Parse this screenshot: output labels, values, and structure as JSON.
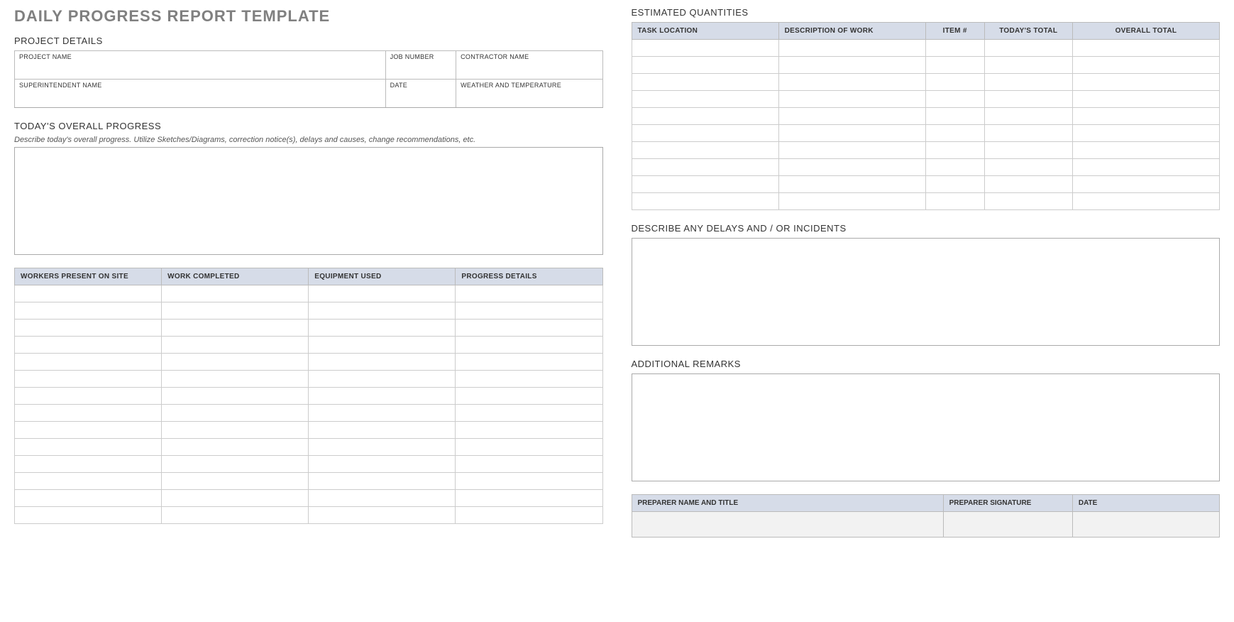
{
  "title": "DAILY PROGRESS REPORT TEMPLATE",
  "sections": {
    "project_details": "PROJECT DETAILS",
    "todays_progress": "TODAY'S OVERALL PROGRESS",
    "estimated_quantities": "ESTIMATED QUANTITIES",
    "delays": "DESCRIBE ANY DELAYS AND / OR INCIDENTS",
    "remarks": "ADDITIONAL REMARKS"
  },
  "project_details": {
    "fields": {
      "project_name": {
        "label": "PROJECT NAME",
        "value": ""
      },
      "job_number": {
        "label": "JOB NUMBER",
        "value": ""
      },
      "contractor_name": {
        "label": "CONTRACTOR NAME",
        "value": ""
      },
      "superintendent_name": {
        "label": "SUPERINTENDENT NAME",
        "value": ""
      },
      "date": {
        "label": "DATE",
        "value": ""
      },
      "weather": {
        "label": "WEATHER AND TEMPERATURE",
        "value": ""
      }
    }
  },
  "todays_progress": {
    "hint": "Describe today's overall progress.  Utilize Sketches/Diagrams, correction notice(s), delays and causes, change recommendations, etc.",
    "value": ""
  },
  "work_table": {
    "headers": [
      "WORKERS PRESENT ON SITE",
      "WORK COMPLETED",
      "EQUIPMENT USED",
      "PROGRESS DETAILS"
    ],
    "row_count": 14
  },
  "quantities_table": {
    "headers": [
      "TASK LOCATION",
      "DESCRIPTION OF WORK",
      "ITEM #",
      "TODAY'S TOTAL",
      "OVERALL TOTAL"
    ],
    "row_count": 10
  },
  "delays": {
    "value": ""
  },
  "remarks": {
    "value": ""
  },
  "signature": {
    "headers": [
      "PREPARER NAME AND TITLE",
      "PREPARER SIGNATURE",
      "DATE"
    ],
    "values": [
      "",
      "",
      ""
    ]
  }
}
